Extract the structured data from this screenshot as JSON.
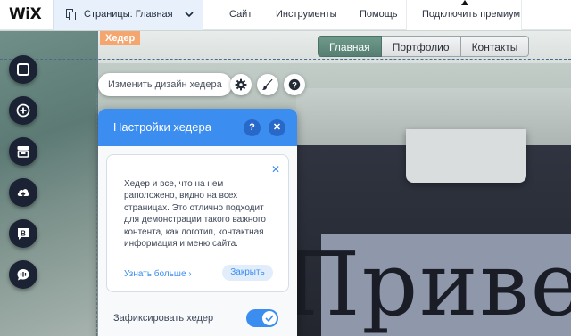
{
  "app": {
    "logo": "WiX"
  },
  "topbar": {
    "pages_label": "Страницы: Главная",
    "menu": [
      "Сайт",
      "Инструменты",
      "Помощь"
    ],
    "premium_label": "Подключить премиум"
  },
  "canvas": {
    "header_tag": "Хедер",
    "nav": [
      "Главная",
      "Портфолио",
      "Контакты"
    ],
    "hero_text": "Приве"
  },
  "left_toolbar": {
    "icons": [
      "square-outline-icon",
      "add-icon",
      "store-icon",
      "upload-cloud-icon",
      "blog-icon",
      "chat-icon"
    ],
    "blog_letter": "B"
  },
  "header_actions": {
    "change_design": "Изменить дизайн хедера",
    "icons": [
      "gear-icon",
      "brush-icon",
      "help-icon"
    ],
    "help_glyph": "?"
  },
  "panel": {
    "title": "Настройки хедера",
    "help_glyph": "?",
    "close_glyph": "✕",
    "tip_close_glyph": "✕",
    "tip_text": "Хедер и все, что на нем раположено, видно на всех страницах. Это отлично подходит для демонстрации такого важного контента, как логотип, контактная информация и меню сайта.",
    "learn_more": "Узнать больше ›",
    "close_button": "Закрыть",
    "fix_header_label": "Зафиксировать хедер",
    "fix_header_on": true
  },
  "colors": {
    "accent": "#3b8df0",
    "toolbar_dark": "#1a2233",
    "header_tag": "#f5a56e",
    "nav_active": "#6e9a8c"
  }
}
